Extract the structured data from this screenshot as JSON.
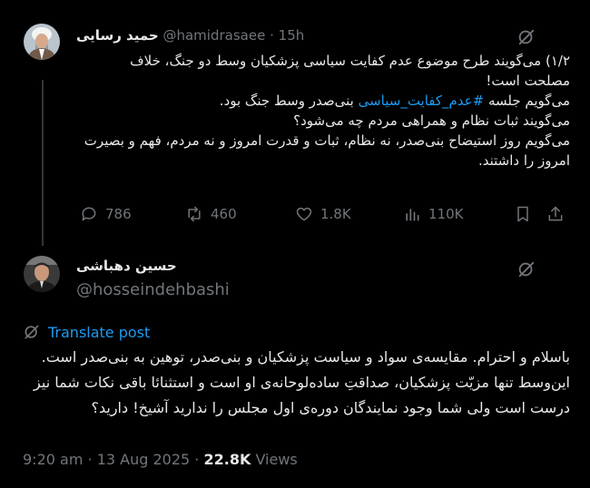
{
  "quoted_post": {
    "author_name": "حمید رسایی",
    "handle": "@hamidrasaee",
    "separator": "·",
    "time": "15h",
    "text_before_hashtag": "۱/۲) می‌گویند طرح موضوع عدم کفایت سیاسی پزشکیان وسط دو جنگ، خلاف مصلحت است!\nمی‌گویم جلسه ",
    "hashtag": "#عدم_کفایت_سیاسی",
    "text_after_hashtag": " بنی‌صدر وسط جنگ بود.\nمی‌گویند ثبات نظام و همراهی مردم چه می‌شود؟\nمی‌گویم روز استیضاح بنی‌صدر، نه نظام، ثبات و قدرت امروز و نه مردم، فهم و بصیرت امروز را داشتند.",
    "replies": "786",
    "reposts": "460",
    "likes": "1.8K",
    "views": "110K"
  },
  "main_post": {
    "author_name": "حسین دهباشی",
    "handle": "@hosseindehbashi",
    "translate_label": "Translate post",
    "text": "باسلام و احترام. مقایسه‌ی سواد و سیاست پزشکیان و بنی‌صدر، توهین به بنی‌صدر است.\nاین‌وسط تنها مزیّت پزشکیان، صداقتِ ساده‌لوحانه‌ی او است و استثنائا باقی نکات شما نیز درست است ولی شما وجود نمایندگان دوره‌ی اول مجلس را ندارید آشیخ! دارید؟",
    "time": "9:20 am",
    "date_separator": "·",
    "date": "13 Aug 2025",
    "views_separator": "·",
    "views_count": "22.8K",
    "views_label": "Views"
  },
  "icons": {
    "grok": "grok-icon",
    "reply": "reply-icon",
    "repost": "repost-icon",
    "like": "heart-icon",
    "views": "analytics-icon",
    "bookmark": "bookmark-icon",
    "translate": "translate-icon"
  },
  "colors": {
    "background": "#000000",
    "text": "#e7e9ea",
    "muted": "#71767b",
    "accent": "#1d9bf0"
  }
}
